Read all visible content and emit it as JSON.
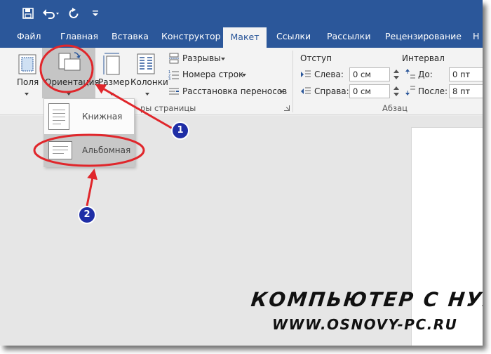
{
  "tabs": [
    "Файл",
    "Главная",
    "Вставка",
    "Конструктор",
    "Макет",
    "Ссылки",
    "Рассылки",
    "Рецензирование",
    "Н"
  ],
  "active_tab": "Макет",
  "page_setup": {
    "margins_label": "Поля",
    "orientation_label": "Ориентация",
    "size_label": "Размер",
    "columns_label": "Колонки",
    "breaks_label": "Разрывы",
    "line_numbers_label": "Номера строк",
    "hyphenation_label": "Расстановка переносов",
    "group_label": "ры страницы"
  },
  "paragraph": {
    "indent_header": "Отступ",
    "spacing_header": "Интервал",
    "left_label": "Слева:",
    "left_value": "0 см",
    "right_label": "Справа:",
    "right_value": "0 см",
    "before_label": "До:",
    "before_value": "0 пт",
    "after_label": "После:",
    "after_value": "8 пт",
    "group_label": "Абзац"
  },
  "orientation_menu": {
    "portrait": "Книжная",
    "landscape": "Альбомная",
    "selected": "Альбомная"
  },
  "callouts": [
    "1",
    "2"
  ],
  "watermark": {
    "line1": "КОМПЬЮТЕР С НУЛЯ",
    "line2": "WWW.OSNOVY-PC.RU"
  },
  "colors": {
    "ribbon_blue": "#2b579a",
    "callout_red": "#e0262b",
    "badge_blue": "#1f2ea6"
  }
}
